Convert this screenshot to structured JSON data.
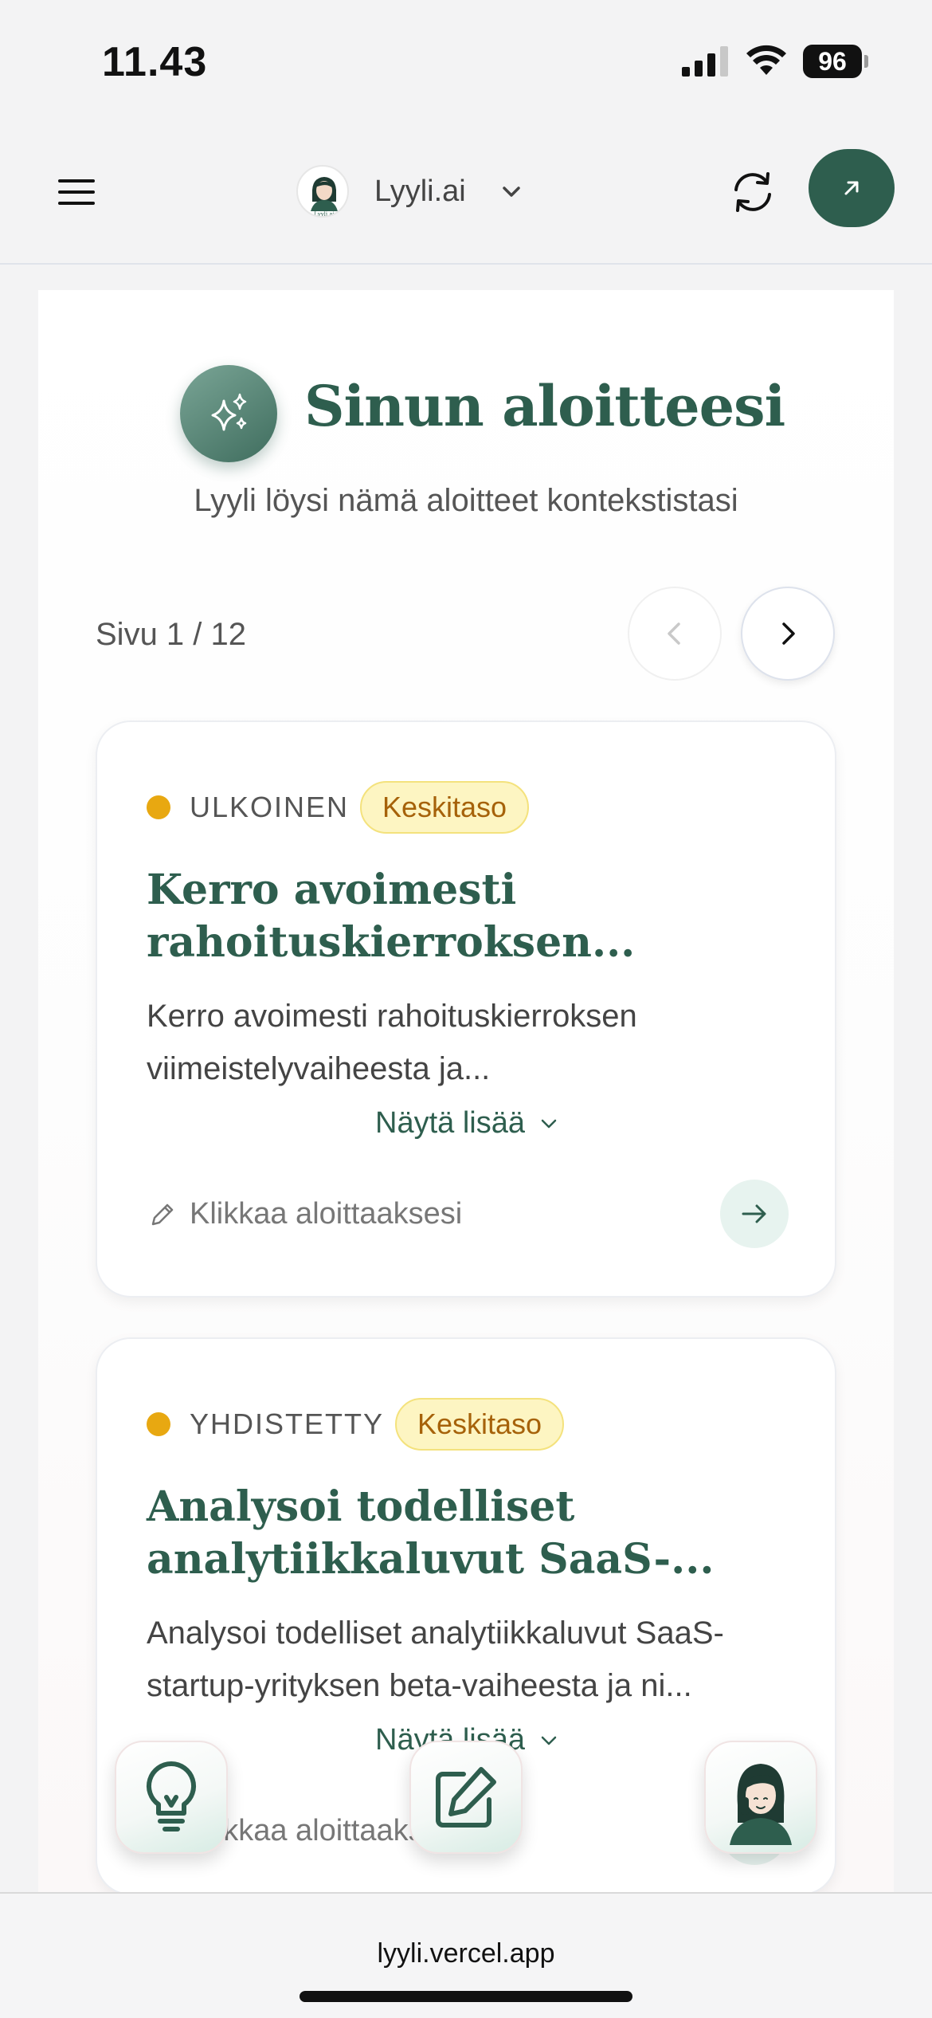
{
  "status_bar": {
    "time": "11.43",
    "battery": "96"
  },
  "header": {
    "brand_name": "Lyyli.ai",
    "avatar_caption": "Lyyli.ai"
  },
  "hero": {
    "title": "Sinun aloitteesi",
    "subtitle": "Lyyli löysi nämä aloitteet kontekstistasi"
  },
  "pager": {
    "label": "Sivu 1 / 12"
  },
  "cards": [
    {
      "type": "ULKOINEN",
      "level": "Keskitaso",
      "title": "Kerro avoimesti rahoituskierroksen...",
      "description": "Kerro avoimesti rahoituskierroksen viimeistelyvaiheesta ja...",
      "show_more": "Näytä lisää",
      "start_label": "Klikkaa aloittaaksesi"
    },
    {
      "type": "YHDISTETTY",
      "level": "Keskitaso",
      "title": "Analysoi todelliset analytiikkaluvut SaaS-...",
      "description": "Analysoi todelliset analytiikkaluvut SaaS-startup-yrityksen beta-vaiheesta ja ni...",
      "show_more": "Näytä lisää",
      "start_label": "Klikkaa aloittaaksesi"
    }
  ],
  "fabs": {
    "ideas_icon": "lightbulb-icon",
    "write_icon": "pencil-square-icon",
    "assistant_icon": "assistant-avatar-icon"
  },
  "browser": {
    "url": "lyyli.vercel.app"
  },
  "colors": {
    "brand_green": "#2e5e4e",
    "badge_bg": "#fdf5c2",
    "badge_text": "#a6620a",
    "dot": "#e8a811"
  }
}
